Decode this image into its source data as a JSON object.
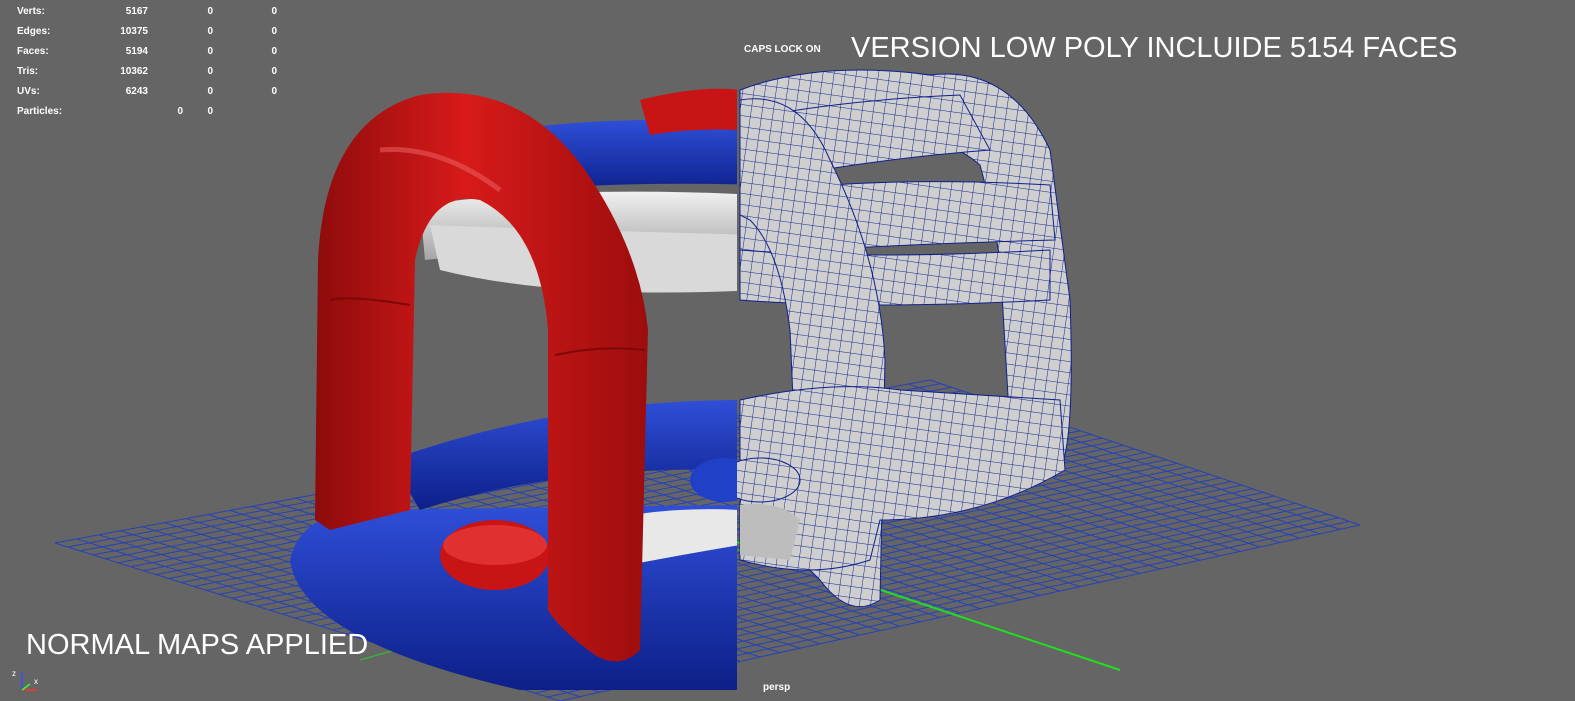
{
  "hud": {
    "rows": [
      {
        "label": "Verts:",
        "v1": "5167",
        "v2": "0",
        "v3": "0"
      },
      {
        "label": "Edges:",
        "v1": "10375",
        "v2": "0",
        "v3": "0"
      },
      {
        "label": "Faces:",
        "v1": "5194",
        "v2": "0",
        "v3": "0"
      },
      {
        "label": "Tris:",
        "v1": "10362",
        "v2": "0",
        "v3": "0"
      },
      {
        "label": "UVs:",
        "v1": "6243",
        "v2": "0",
        "v3": "0"
      },
      {
        "label": "Particles:",
        "v1": "0",
        "v2": "0",
        "v3": ""
      }
    ]
  },
  "caps_lock": "CAPS LOCK ON",
  "title_right": "VERSION LOW POLY INCLUIDE 5154 FACES",
  "title_left": "NORMAL MAPS APPLIED",
  "camera": "persp",
  "colors": {
    "background": "#656565",
    "grid": "#1f3fbf",
    "grid_axis": "#22dd22",
    "red": "#c81414",
    "blue": "#1633b8",
    "white_tube": "#d8d8d8",
    "wire": "#10208a"
  },
  "axis_gizmo": {
    "labels": [
      "z",
      "x"
    ]
  }
}
